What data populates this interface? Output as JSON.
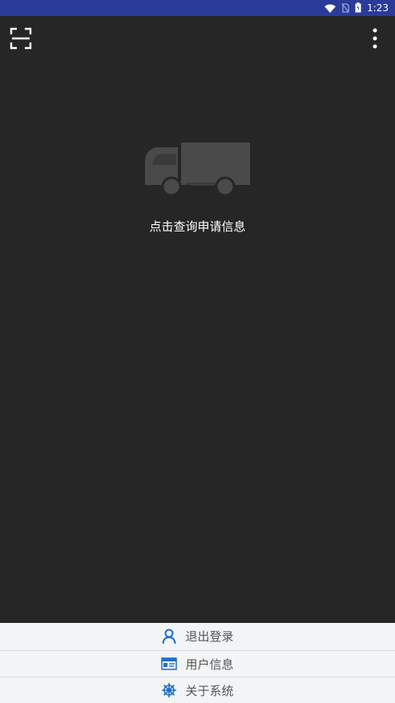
{
  "status_bar": {
    "time": "1:23"
  },
  "toolbar": {
    "scan_icon": "scan-icon",
    "more_icon": "more-vertical-icon"
  },
  "main": {
    "empty_message": "点击查询申请信息",
    "illustration": "truck-icon"
  },
  "bottom_menu": {
    "items": [
      {
        "label": "退出登录",
        "icon": "user-icon"
      },
      {
        "label": "用户信息",
        "icon": "id-card-icon"
      },
      {
        "label": "关于系统",
        "icon": "helm-icon"
      }
    ]
  },
  "colors": {
    "status_bar": "#2a3b9a",
    "background": "#262626",
    "menu_bg": "#f3f4f6",
    "icon_blue": "#1e6fc4"
  }
}
